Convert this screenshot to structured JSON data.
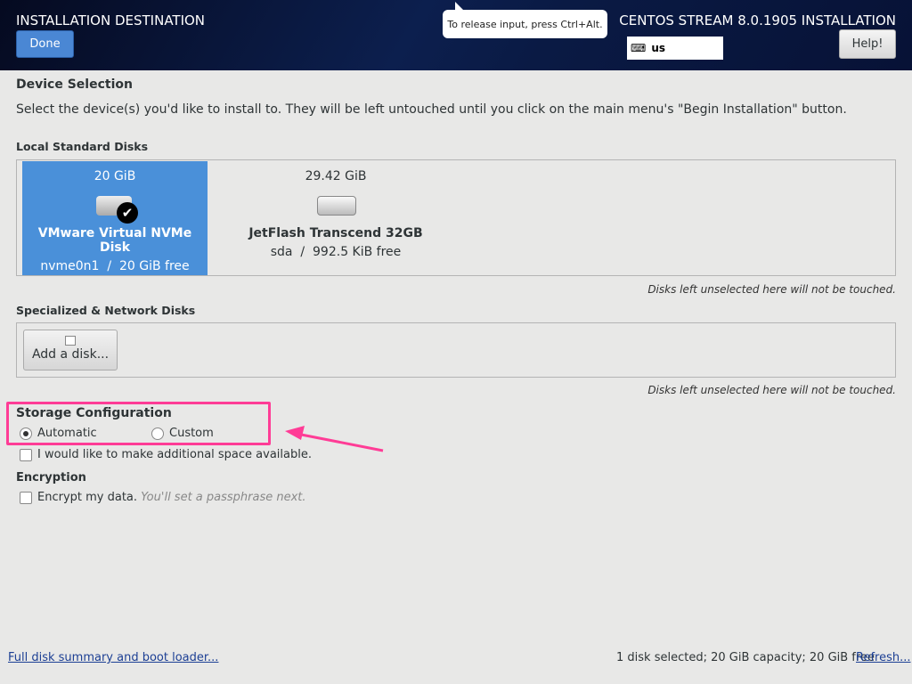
{
  "header": {
    "title": "INSTALLATION DESTINATION",
    "done": "Done",
    "tooltip": "To release input, press Ctrl+Alt.",
    "product": "CENTOS STREAM 8.0.1905 INSTALLATION",
    "keyboard": "us",
    "help": "Help!"
  },
  "device_selection": {
    "heading": "Device Selection",
    "description": "Select the device(s) you'd like to install to.  They will be left untouched until you click on the main menu's \"Begin Installation\" button."
  },
  "local": {
    "heading": "Local Standard Disks",
    "disks": [
      {
        "size": "20 GiB",
        "name": "VMware Virtual NVMe Disk",
        "device": "nvme0n1",
        "free": "20 GiB free",
        "selected": true
      },
      {
        "size": "29.42 GiB",
        "name": "JetFlash Transcend 32GB",
        "device": "sda",
        "free": "992.5 KiB free",
        "selected": false
      }
    ],
    "note": "Disks left unselected here will not be touched."
  },
  "specialized": {
    "heading": "Specialized & Network Disks",
    "add": "Add a disk...",
    "note": "Disks left unselected here will not be touched."
  },
  "storage": {
    "heading": "Storage Configuration",
    "automatic": "Automatic",
    "custom": "Custom",
    "selected": "Automatic",
    "additional": "I would like to make additional space available."
  },
  "encryption": {
    "heading": "Encryption",
    "encrypt": "Encrypt my data.",
    "hint": "You'll set a passphrase next."
  },
  "footer": {
    "summary_link": "Full disk summary and boot loader...",
    "status": "1 disk selected; 20 GiB capacity; 20 GiB free",
    "refresh": "Refresh..."
  },
  "colors": {
    "accent": "#4a90d9",
    "highlight": "#ff3c96"
  }
}
